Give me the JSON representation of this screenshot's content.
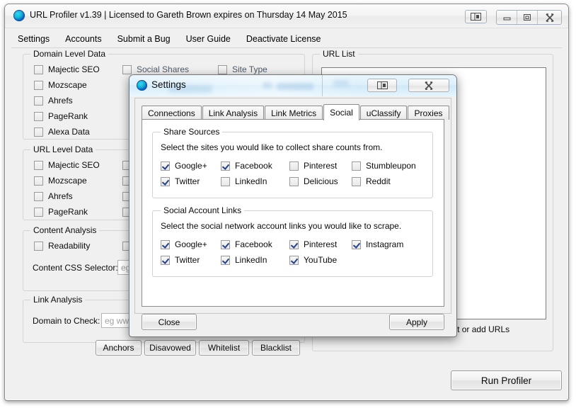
{
  "window": {
    "title": "URL Profiler v1.39 | Licensed to Gareth Brown expires on Thursday 14 May 2015",
    "app_icon": "url-profiler-orb-icon",
    "titlebar_buttons": [
      {
        "name": "help-toggle-icon",
        "glyph": "❐"
      },
      {
        "name": "minimize-icon",
        "glyph": "—"
      },
      {
        "name": "maximize-icon",
        "glyph": "□"
      },
      {
        "name": "close-icon",
        "glyph": "✕"
      }
    ]
  },
  "menubar": {
    "items": [
      {
        "label": "Settings"
      },
      {
        "label": "Accounts"
      },
      {
        "label": "Submit a Bug"
      },
      {
        "label": "User Guide"
      },
      {
        "label": "Deactivate License"
      }
    ]
  },
  "main": {
    "domain_level_data": {
      "title": "Domain Level Data",
      "col1": [
        {
          "label": "Majectic SEO",
          "checked": false
        },
        {
          "label": "Mozscape",
          "checked": false
        },
        {
          "label": "Ahrefs",
          "checked": false
        },
        {
          "label": "PageRank",
          "checked": false
        },
        {
          "label": "Alexa Data",
          "checked": false
        }
      ],
      "col2": [
        {
          "label": "Social Shares",
          "checked": false
        }
      ],
      "col3": [
        {
          "label": "Site Type",
          "checked": false
        }
      ]
    },
    "url_level_data": {
      "title": "URL Level Data",
      "col1": [
        {
          "label": "Majectic SEO",
          "checked": false
        },
        {
          "label": "Mozscape",
          "checked": false
        },
        {
          "label": "Ahrefs",
          "checked": false
        },
        {
          "label": "PageRank",
          "checked": false
        }
      ]
    },
    "content_analysis": {
      "title": "Content Analysis",
      "col1": [
        {
          "label": "Readability",
          "checked": false
        }
      ],
      "css_selector_label": "Content CSS Selector:",
      "css_selector_placeholder": "eg c"
    },
    "link_analysis": {
      "title": "Link Analysis",
      "domain_label": "Domain to Check:",
      "domain_placeholder": "eg www"
    },
    "bottom_buttons": [
      {
        "label": "Anchors"
      },
      {
        "label": "Disavowed"
      },
      {
        "label": "Whitelist"
      },
      {
        "label": "Blacklist"
      }
    ],
    "url_list": {
      "title": "URL List",
      "hint": "Right click on the list above to import or add URLs",
      "run_button": "Run Profiler"
    }
  },
  "settings_dialog": {
    "title": "Settings",
    "icon": "url-profiler-orb-icon",
    "titlebar_buttons": [
      {
        "name": "help-toggle-icon",
        "glyph": "❐"
      },
      {
        "name": "close-icon",
        "glyph": "✕"
      }
    ],
    "tabs": [
      {
        "label": "Connections",
        "active": false
      },
      {
        "label": "Link Analysis",
        "active": false
      },
      {
        "label": "Link Metrics",
        "active": false
      },
      {
        "label": "Social",
        "active": true
      },
      {
        "label": "uClassify",
        "active": false
      },
      {
        "label": "Proxies",
        "active": false
      }
    ],
    "share_sources": {
      "title": "Share Sources",
      "description": "Select the sites you would like to collect share counts from.",
      "items": [
        {
          "label": "Google+",
          "checked": true,
          "col": 0,
          "row": 0
        },
        {
          "label": "Facebook",
          "checked": true,
          "col": 1,
          "row": 0
        },
        {
          "label": "Pinterest",
          "checked": false,
          "col": 2,
          "row": 0
        },
        {
          "label": "Stumbleupon",
          "checked": false,
          "col": 3,
          "row": 0
        },
        {
          "label": "Twitter",
          "checked": true,
          "col": 0,
          "row": 1
        },
        {
          "label": "LinkedIn",
          "checked": false,
          "col": 1,
          "row": 1
        },
        {
          "label": "Delicious",
          "checked": false,
          "col": 2,
          "row": 1
        },
        {
          "label": "Reddit",
          "checked": false,
          "col": 3,
          "row": 1
        }
      ]
    },
    "social_account_links": {
      "title": "Social Account Links",
      "description": "Select the social network account links you would like to scrape.",
      "items": [
        {
          "label": "Google+",
          "checked": true,
          "col": 0,
          "row": 0
        },
        {
          "label": "Facebook",
          "checked": true,
          "col": 1,
          "row": 0
        },
        {
          "label": "Pinterest",
          "checked": true,
          "col": 2,
          "row": 0
        },
        {
          "label": "Instagram",
          "checked": true,
          "col": 3,
          "row": 0
        },
        {
          "label": "Twitter",
          "checked": true,
          "col": 0,
          "row": 1
        },
        {
          "label": "LinkedIn",
          "checked": true,
          "col": 1,
          "row": 1
        },
        {
          "label": "YouTube",
          "checked": true,
          "col": 2,
          "row": 1
        }
      ]
    },
    "footer": {
      "close_label": "Close",
      "apply_label": "Apply"
    }
  },
  "colors": {
    "window_bg": "#f0f0f0",
    "panel_white": "#ffffff",
    "checkmark": "#27408b",
    "glass_blue": "#dcf0fb",
    "text": "#0b0b0b"
  }
}
